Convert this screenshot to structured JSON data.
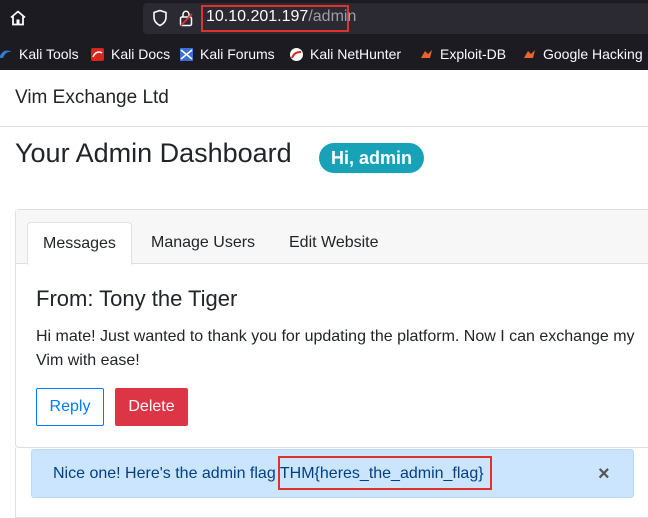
{
  "browser": {
    "url_host": "10.10.201.197",
    "url_path": "/admin",
    "bookmarks": [
      {
        "label": "Kali Tools",
        "icon": "kali-icon"
      },
      {
        "label": "Kali Docs",
        "icon": "kali-docs-icon"
      },
      {
        "label": "Kali Forums",
        "icon": "kali-forums-icon"
      },
      {
        "label": "Kali NetHunter",
        "icon": "nethunter-icon"
      },
      {
        "label": "Exploit-DB",
        "icon": "exploit-db-icon"
      },
      {
        "label": "Google Hacking",
        "icon": "google-hacking-icon"
      }
    ]
  },
  "navbar": {
    "brand": "Vim Exchange Ltd"
  },
  "header": {
    "title": "Your Admin Dashboard",
    "badge": "Hi, admin"
  },
  "tabs": [
    {
      "label": "Messages",
      "active": true
    },
    {
      "label": "Manage Users",
      "active": false
    },
    {
      "label": "Edit Website",
      "active": false
    }
  ],
  "message": {
    "title": "From: Tony the Tiger",
    "body": "Hi mate! Just wanted to thank you for updating the platform. Now I can exchange my Vim with ease!",
    "reply_label": "Reply",
    "delete_label": "Delete"
  },
  "alert": {
    "text": "Nice one! Here's the admin flag ",
    "flag": "THM{heres_the_admin_flag}",
    "close": "×"
  },
  "colors": {
    "badge": "#17a2b8",
    "reply": "#007bff",
    "delete": "#dc3545",
    "alert_bg": "#cce5ff",
    "highlight": "#e03131"
  }
}
